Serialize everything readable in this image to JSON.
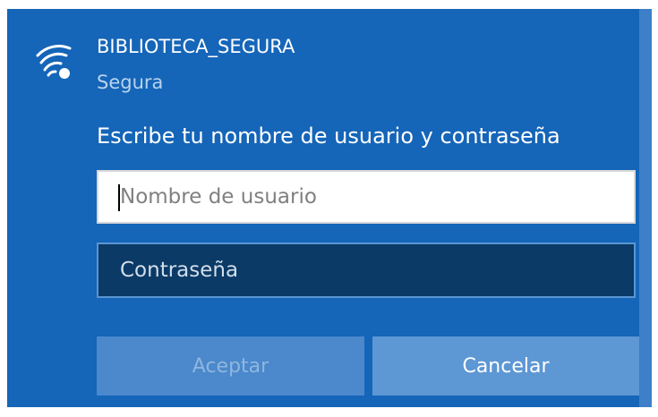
{
  "network": {
    "name": "BIBLIOTECA_SEGURA",
    "status": "Segura",
    "icon": "wifi-secured-icon"
  },
  "login": {
    "prompt": "Escribe tu nombre de usuario y contraseña",
    "username_placeholder": "Nombre de usuario",
    "username_value": "",
    "password_placeholder": "Contraseña",
    "password_value": ""
  },
  "buttons": {
    "accept_label": "Aceptar",
    "accept_enabled": false,
    "cancel_label": "Cancelar"
  },
  "colors": {
    "panel": "#1565b8",
    "accept_button": "#4b88cc",
    "cancel_button": "#5d97d4",
    "password_field": "#0b3a66"
  }
}
